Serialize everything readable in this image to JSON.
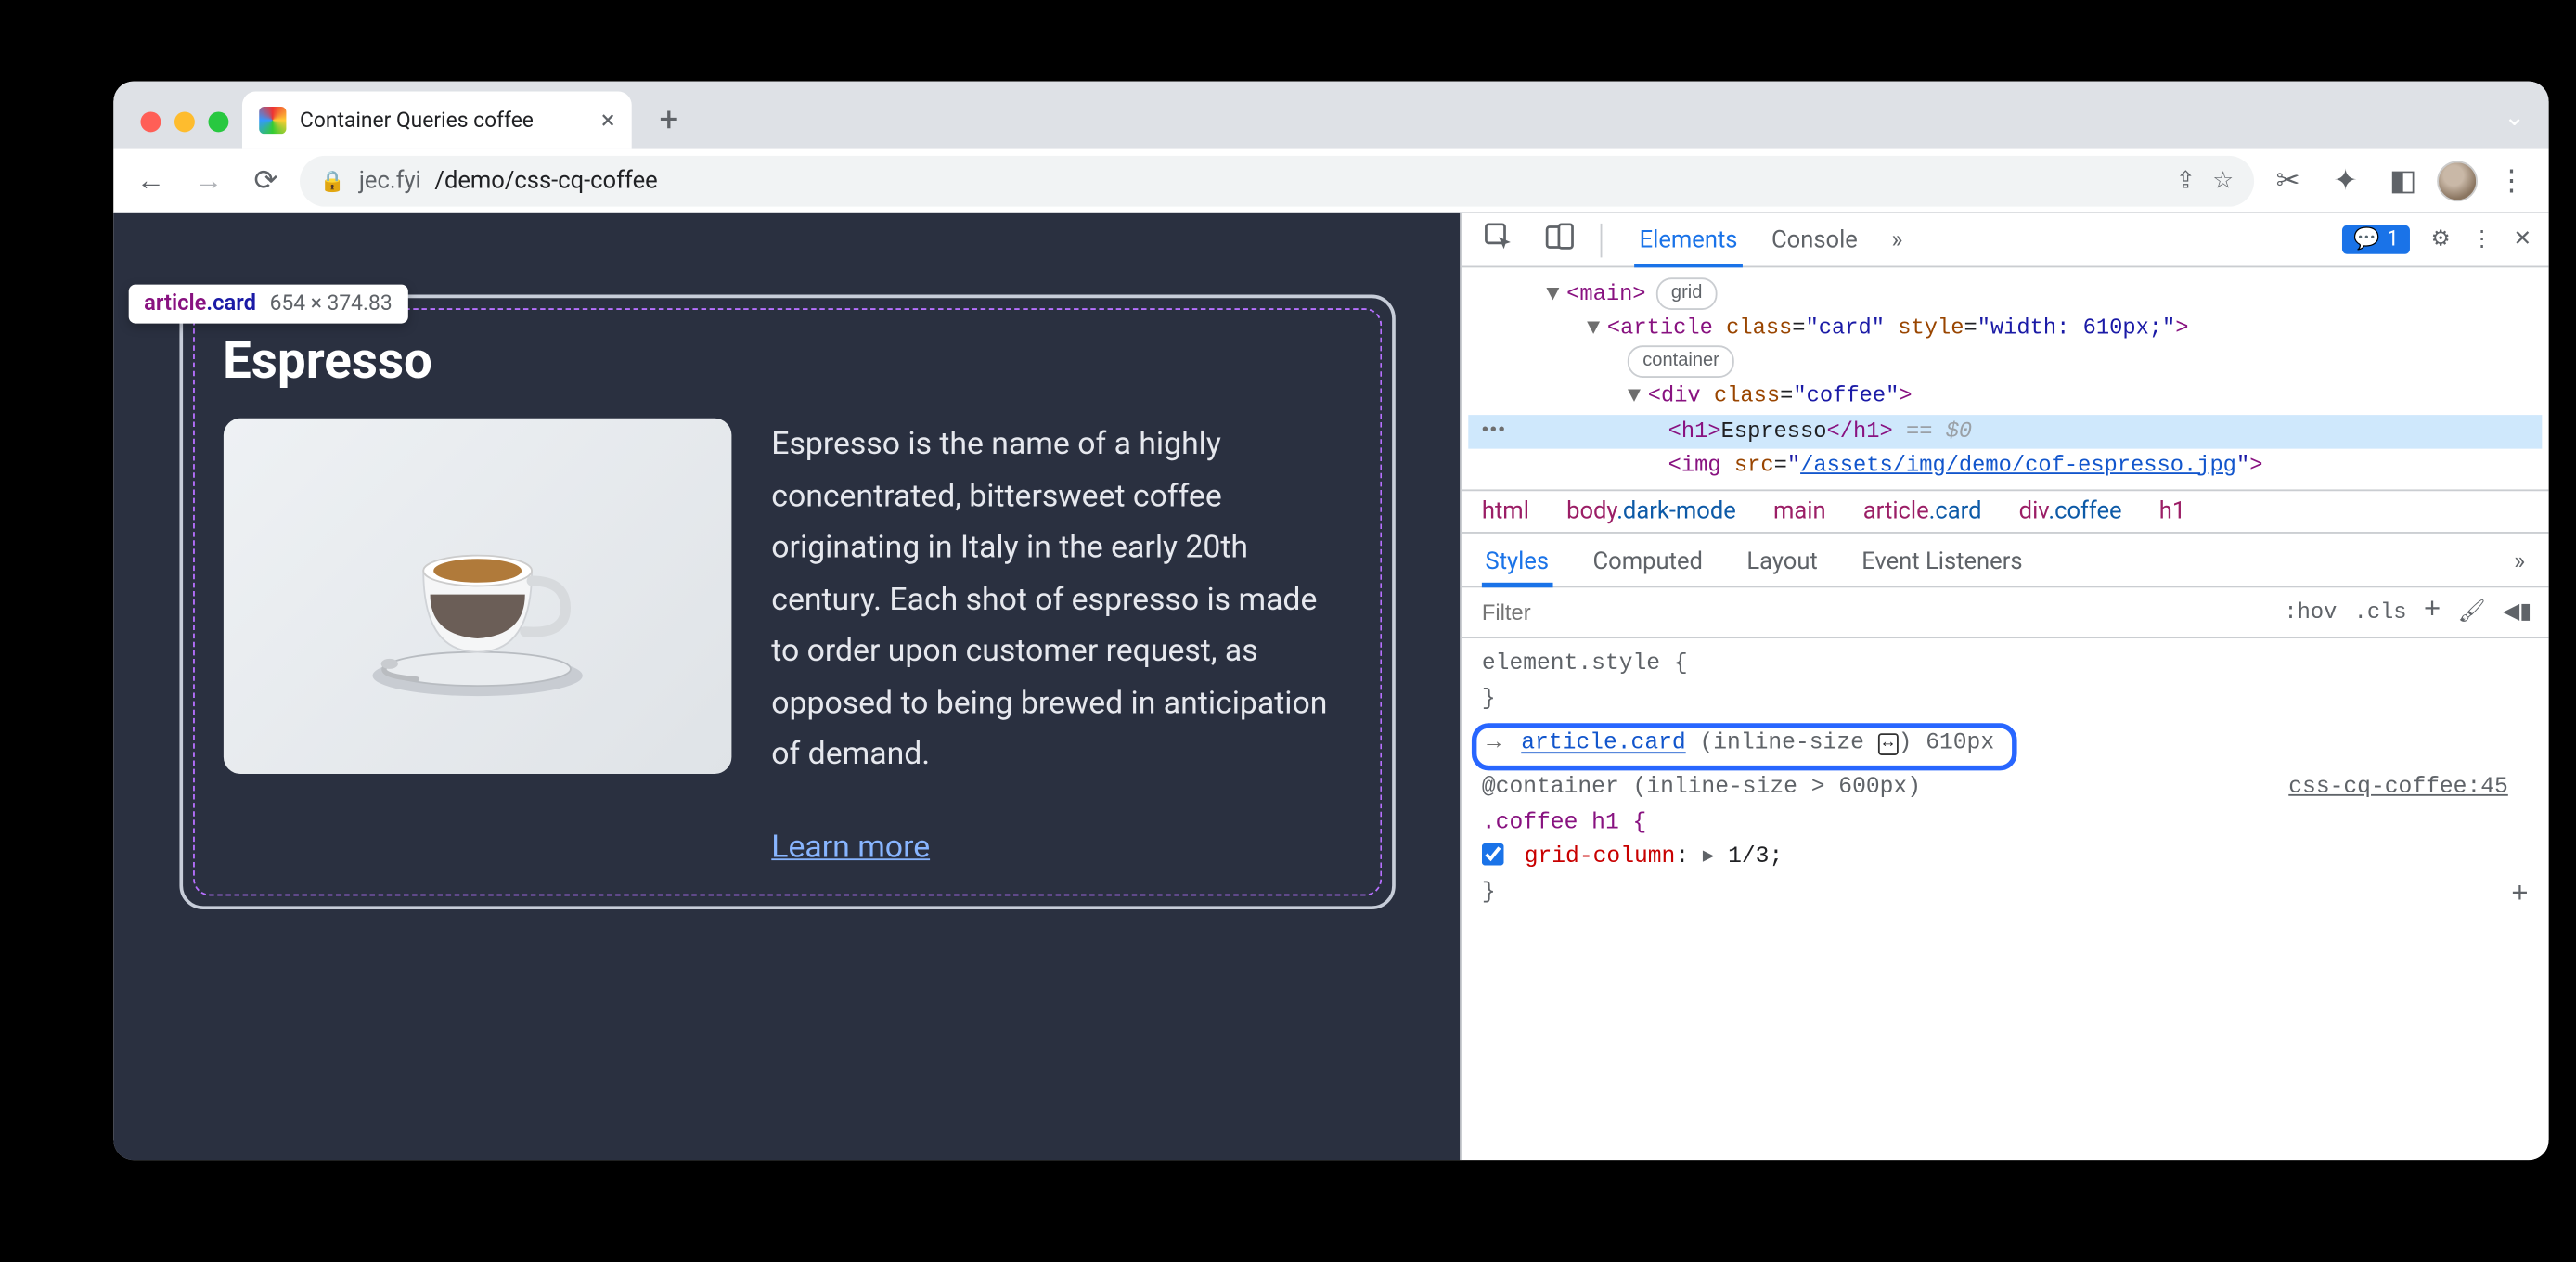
{
  "browser": {
    "tab_title": "Container Queries coffee",
    "url_host": "jec.fyi",
    "url_path": "/demo/css-cq-coffee"
  },
  "inspector_tooltip": {
    "selector_tag": "article",
    "selector_class": ".card",
    "dimensions": "654 × 374.83"
  },
  "page": {
    "heading": "Espresso",
    "description": "Espresso is the name of a highly concentrated, bittersweet coffee originating in Italy in the early 20th century. Each shot of espresso is made to order upon customer request, as opposed to being brewed in anticipation of demand.",
    "learn_more": "Learn more"
  },
  "devtools": {
    "tabs": {
      "elements": "Elements",
      "console": "Console"
    },
    "issues_count": "1",
    "dom": {
      "main_open": "<main>",
      "main_badge": "grid",
      "article_open": "<article class=\"card\" style=\"width: 610px;\">",
      "article_badge": "container",
      "div_open": "<div class=\"coffee\">",
      "h1": "<h1>Espresso</h1>",
      "h1_suffix": " == $0",
      "img": "<img src=\"",
      "img_src": "/assets/img/demo/cof-espresso.jpg",
      "img_close": "\">"
    },
    "breadcrumb": [
      "html",
      "body.dark-mode",
      "main",
      "article.card",
      "div.coffee",
      "h1"
    ],
    "styles_tabs": {
      "styles": "Styles",
      "computed": "Computed",
      "layout": "Layout",
      "listeners": "Event Listeners"
    },
    "filter_placeholder": "Filter",
    "toggles": {
      "hov": ":hov",
      "cls": ".cls"
    },
    "rules": {
      "element_style": "element.style {",
      "close": "}",
      "callout_selector": "article.card",
      "callout_text_open": " (inline-size ",
      "callout_text_close": ") 610px",
      "container_line": "@container (inline-size > 600px)",
      "selector_line": ".coffee h1 {",
      "source": "css-cq-coffee:45",
      "prop": "grid-column",
      "val": "1/3",
      "triangle": "▸"
    }
  }
}
